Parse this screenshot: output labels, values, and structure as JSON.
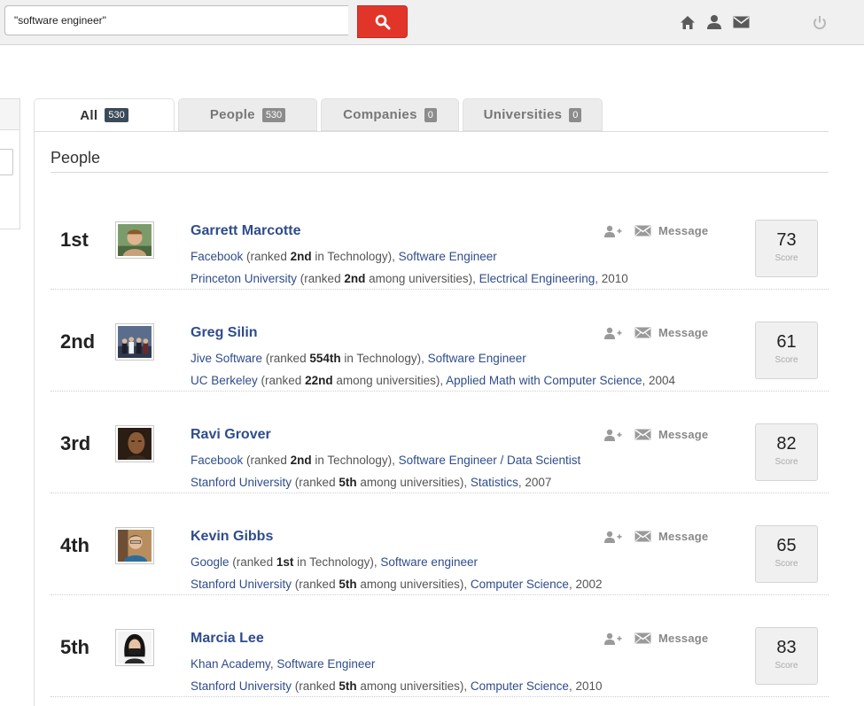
{
  "search": {
    "value": "\"software engineer\""
  },
  "colors": {
    "accent": "#e2352a",
    "link": "#2f4c8c",
    "badge_active": "#3b4a59",
    "badge": "#8c8c8c"
  },
  "nav": {
    "icons": [
      "home-icon",
      "user-icon",
      "mail-icon",
      "power-icon"
    ]
  },
  "tabs": [
    {
      "label": "All",
      "count": "530"
    },
    {
      "label": "People",
      "count": "530"
    },
    {
      "label": "Companies",
      "count": "0"
    },
    {
      "label": "Universities",
      "count": "0"
    }
  ],
  "section": {
    "title": "People"
  },
  "actions": {
    "message_label": "Message",
    "score_label": "Score"
  },
  "results": [
    {
      "rank": "1st",
      "name": "Garrett Marcotte",
      "score": "73",
      "company": "Facebook",
      "company_rank_prefix": " (ranked ",
      "company_rank": "2nd",
      "company_rank_suffix": " in Technology), ",
      "title": "Software Engineer",
      "school": "Princeton University",
      "school_rank_prefix": " (ranked ",
      "school_rank": "2nd",
      "school_rank_suffix": " among universities), ",
      "major": "Electrical Engineering",
      "year": ", 2010"
    },
    {
      "rank": "2nd",
      "name": "Greg Silin",
      "score": "61",
      "company": "Jive Software",
      "company_rank_prefix": " (ranked ",
      "company_rank": "554th",
      "company_rank_suffix": " in Technology), ",
      "title": "Software Engineer",
      "school": "UC Berkeley",
      "school_rank_prefix": " (ranked ",
      "school_rank": "22nd",
      "school_rank_suffix": " among universities), ",
      "major": "Applied Math with Computer Science",
      "year": ", 2004"
    },
    {
      "rank": "3rd",
      "name": "Ravi Grover",
      "score": "82",
      "company": "Facebook",
      "company_rank_prefix": " (ranked ",
      "company_rank": "2nd",
      "company_rank_suffix": " in Technology), ",
      "title": "Software Engineer / Data Scientist",
      "school": "Stanford University",
      "school_rank_prefix": " (ranked ",
      "school_rank": "5th",
      "school_rank_suffix": " among universities), ",
      "major": "Statistics",
      "year": ", 2007"
    },
    {
      "rank": "4th",
      "name": "Kevin Gibbs",
      "score": "65",
      "company": "Google",
      "company_rank_prefix": " (ranked ",
      "company_rank": "1st",
      "company_rank_suffix": " in Technology), ",
      "title": "Software engineer",
      "school": "Stanford University",
      "school_rank_prefix": " (ranked ",
      "school_rank": "5th",
      "school_rank_suffix": " among universities), ",
      "major": "Computer Science",
      "year": ", 2002"
    },
    {
      "rank": "5th",
      "name": "Marcia Lee",
      "score": "83",
      "company": "Khan Academy",
      "company_rank_prefix": ", ",
      "company_rank": "",
      "company_rank_suffix": "",
      "title": "Software Engineer",
      "school": "Stanford University",
      "school_rank_prefix": " (ranked ",
      "school_rank": "5th",
      "school_rank_suffix": " among universities), ",
      "major": "Computer Science",
      "year": ", 2010"
    }
  ]
}
